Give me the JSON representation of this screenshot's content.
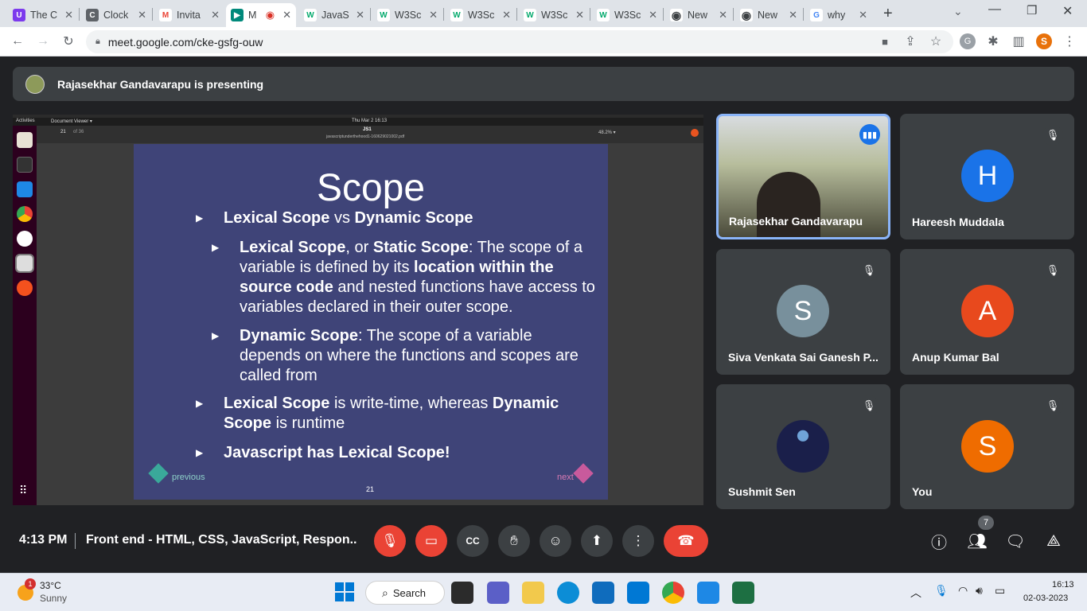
{
  "browser": {
    "tabs": [
      {
        "title": "The C",
        "fav": "U",
        "color": "#7c3aed"
      },
      {
        "title": "Clock",
        "fav": "C",
        "color": "#5f6368"
      },
      {
        "title": "Invita",
        "fav": "M",
        "color": "#ea4335"
      },
      {
        "title": "M",
        "fav": "▶",
        "color": "#00897b"
      },
      {
        "title": "JavaS",
        "fav": "W",
        "color": "#04aa6d"
      },
      {
        "title": "W3Sc",
        "fav": "W",
        "color": "#04aa6d"
      },
      {
        "title": "W3Sc",
        "fav": "W",
        "color": "#04aa6d"
      },
      {
        "title": "W3Sc",
        "fav": "W",
        "color": "#04aa6d"
      },
      {
        "title": "W3Sc",
        "fav": "W",
        "color": "#04aa6d"
      },
      {
        "title": "New",
        "fav": "◉",
        "color": "#3c4043"
      },
      {
        "title": "New",
        "fav": "◉",
        "color": "#3c4043"
      },
      {
        "title": "why",
        "fav": "G",
        "color": "#4285f4"
      }
    ],
    "url": "meet.google.com/cke-gsfg-ouw",
    "profile_initial": "S",
    "ext_initial": "G"
  },
  "meet": {
    "presenting": "Rajasekhar Gandavarapu is presenting",
    "time": "4:13 PM",
    "meeting_title": "Front end - HTML, CSS, JavaScript, Respon...",
    "people_count": "7",
    "participants": [
      {
        "name": "Rajasekhar Gandavarapu",
        "initial": "",
        "color": ""
      },
      {
        "name": "Hareesh Muddala",
        "initial": "H",
        "color": "#1a73e8"
      },
      {
        "name": "Siva Venkata Sai Ganesh P...",
        "initial": "S",
        "color": "#78909c"
      },
      {
        "name": "Anup Kumar Bal",
        "initial": "A",
        "color": "#e8491d"
      },
      {
        "name": "Sushmit Sen",
        "initial": "",
        "color": ""
      },
      {
        "name": "You",
        "initial": "S",
        "color": "#ef6c00"
      }
    ]
  },
  "shared_screen": {
    "topbar_left": "Activities",
    "topbar_app": "Document Viewer ▾",
    "topbar_clock": "Thu Mar 2 16:13",
    "pdf_title": "JS1",
    "pdf_file": "javascriptunderthehood1-160629021002.pdf",
    "page": "21",
    "page_of": "of 36",
    "zoom": "48.2% ▾",
    "slide": {
      "title": "Scope",
      "bullet1_a": "Lexical Scope",
      "bullet1_b": " vs ",
      "bullet1_c": "Dynamic Scope",
      "sub1_a": "Lexical Scope",
      "sub1_b": ", or ",
      "sub1_c": "Static Scope",
      "sub1_d": ": The scope of a variable is defined by its ",
      "sub1_e": "location within the source code",
      "sub1_f": " and nested functions have access to variables declared in their outer scope.",
      "sub2_a": "Dynamic Scope",
      "sub2_b": ": The scope of a variable depends on where the functions and scopes are called from",
      "bullet2_a": "Lexical Scope",
      "bullet2_b": " is write-time, whereas ",
      "bullet2_c": "Dynamic Scope",
      "bullet2_d": " is runtime",
      "bullet3": "Javascript has Lexical Scope!",
      "prev": "previous",
      "next": "next",
      "page_num": "21"
    }
  },
  "taskbar": {
    "weather_temp": "33°C",
    "weather_desc": "Sunny",
    "weather_badge": "1",
    "search": "Search",
    "clock_time": "16:13",
    "clock_date": "02-03-2023"
  }
}
